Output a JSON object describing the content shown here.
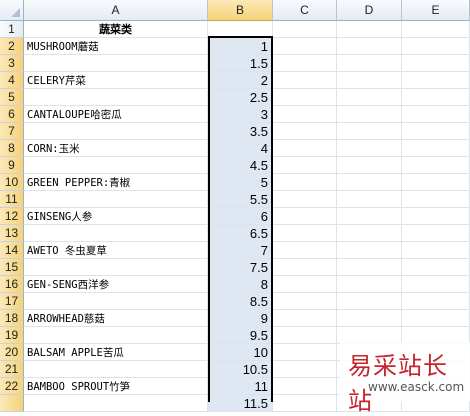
{
  "columns": [
    "A",
    "B",
    "C",
    "D",
    "E"
  ],
  "selected_column": "B",
  "rows": [
    {
      "n": "1",
      "a": "蔬菜类",
      "b": ""
    },
    {
      "n": "2",
      "a": "MUSHROOM蘑菇",
      "b": "1"
    },
    {
      "n": "3",
      "a": "",
      "b": "1.5"
    },
    {
      "n": "4",
      "a": "CELERY芹菜",
      "b": "2"
    },
    {
      "n": "5",
      "a": "",
      "b": "2.5"
    },
    {
      "n": "6",
      "a": "CANTALOUPE哈密瓜",
      "b": "3"
    },
    {
      "n": "7",
      "a": "",
      "b": "3.5"
    },
    {
      "n": "8",
      "a": "CORN:玉米",
      "b": "4"
    },
    {
      "n": "9",
      "a": "",
      "b": "4.5"
    },
    {
      "n": "10",
      "a": "GREEN PEPPER:青椒",
      "b": "5"
    },
    {
      "n": "11",
      "a": "",
      "b": "5.5"
    },
    {
      "n": "12",
      "a": "GINSENG人参",
      "b": "6"
    },
    {
      "n": "13",
      "a": "",
      "b": "6.5"
    },
    {
      "n": "14",
      "a": "AWETO 冬虫夏草",
      "b": "7"
    },
    {
      "n": "15",
      "a": "",
      "b": "7.5"
    },
    {
      "n": "16",
      "a": "GEN-SENG西洋参",
      "b": "8"
    },
    {
      "n": "17",
      "a": "",
      "b": "8.5"
    },
    {
      "n": "18",
      "a": "ARROWHEAD慈菇",
      "b": "9"
    },
    {
      "n": "19",
      "a": "",
      "b": "9.5"
    },
    {
      "n": "20",
      "a": "BALSAM APPLE苦瓜",
      "b": "10"
    },
    {
      "n": "21",
      "a": "",
      "b": "10.5"
    },
    {
      "n": "22",
      "a": "BAMBOO SPROUT竹笋",
      "b": "11"
    },
    {
      "n": "",
      "a": "",
      "b": "11.5"
    }
  ],
  "watermark": {
    "title": "易采站长站",
    "url": "www.easck.com"
  }
}
